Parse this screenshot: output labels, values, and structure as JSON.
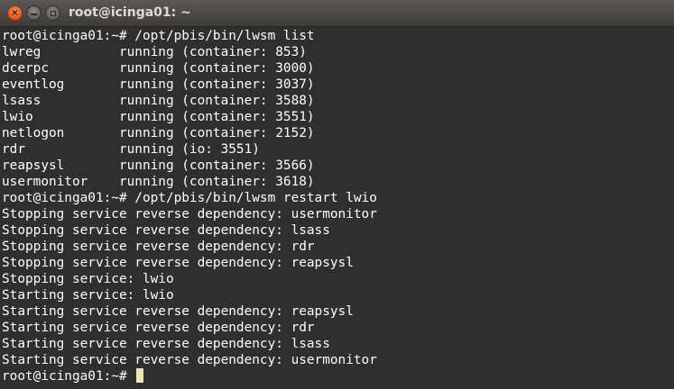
{
  "window": {
    "title": "root@icinga01: ~",
    "close_glyph": "×",
    "accent": "#e95420"
  },
  "terminal": {
    "lines": [
      "root@icinga01:~# /opt/pbis/bin/lwsm list",
      "lwreg          running (container: 853)",
      "dcerpc         running (container: 3000)",
      "eventlog       running (container: 3037)",
      "lsass          running (container: 3588)",
      "lwio           running (container: 3551)",
      "netlogon       running (container: 2152)",
      "rdr            running (io: 3551)",
      "reapsysl       running (container: 3566)",
      "usermonitor    running (container: 3618)",
      "root@icinga01:~# /opt/pbis/bin/lwsm restart lwio",
      "Stopping service reverse dependency: usermonitor",
      "Stopping service reverse dependency: lsass",
      "Stopping service reverse dependency: rdr",
      "Stopping service reverse dependency: reapsysl",
      "Stopping service: lwio",
      "Starting service: lwio",
      "Starting service reverse dependency: reapsysl",
      "Starting service reverse dependency: rdr",
      "Starting service reverse dependency: lsass",
      "Starting service reverse dependency: usermonitor"
    ],
    "prompt": "root@icinga01:~# ",
    "cursor_color": "#ece5b6"
  }
}
